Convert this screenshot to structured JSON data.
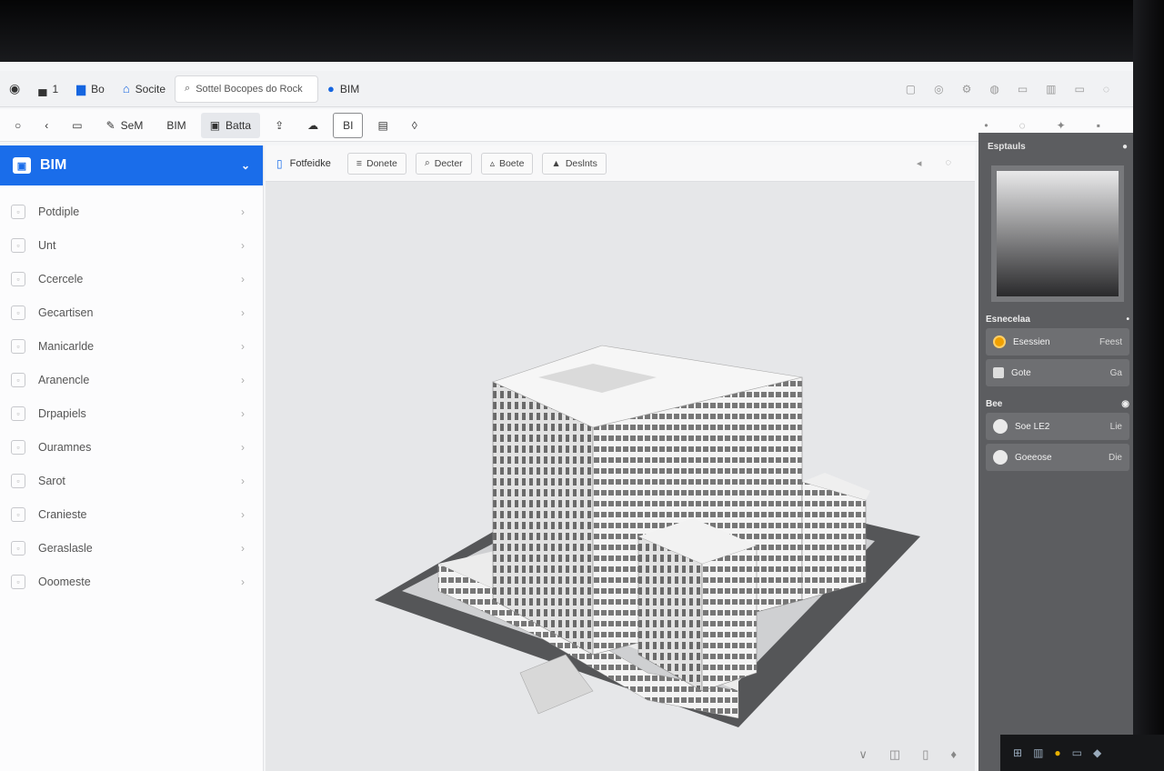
{
  "tabs": [
    {
      "icon": "car-icon",
      "label": "1"
    },
    {
      "icon": "chart-icon",
      "label": "Bo"
    },
    {
      "icon": "home-icon",
      "label": "Socite"
    },
    {
      "icon": "search-icon",
      "label": "Sottel Bocopes do Rock",
      "search": true
    },
    {
      "icon": "info-icon",
      "label": "BIM"
    }
  ],
  "toolbar": {
    "items": [
      {
        "label": "SeM"
      },
      {
        "label": "BIM"
      },
      {
        "label": "Batta",
        "active": true
      },
      {
        "label": ""
      },
      {
        "label": ""
      },
      {
        "label": "BI",
        "boxed": true
      },
      {
        "label": ""
      },
      {
        "label": ""
      }
    ]
  },
  "sidebar": {
    "title": "BIM",
    "items": [
      "Potdiple",
      "Unt",
      "Ccercele",
      "Gecartisen",
      "Manicarlde",
      "Aranencle",
      "Drpapiels",
      "Ouramnes",
      "Sarot",
      "Cranieste",
      "Geraslasle",
      "Ooomeste"
    ]
  },
  "viewport": {
    "title": "Fotfeidke",
    "buttons": [
      "Donete",
      "Decter",
      "Boete",
      "Deslnts"
    ]
  },
  "panel": {
    "title": "Esptauls",
    "section1": "Esnecelaa",
    "rows1": [
      {
        "label": "Esessien",
        "value": "Feest"
      },
      {
        "label": "Gote",
        "value": "Ga"
      }
    ],
    "section2": "Bee",
    "rows2": [
      {
        "label": "Soe LE2",
        "value": "Lie"
      },
      {
        "label": "Goeeose",
        "value": "Die"
      }
    ]
  },
  "colors": {
    "accent": "#1a6dea",
    "panel": "#5c5d60"
  }
}
